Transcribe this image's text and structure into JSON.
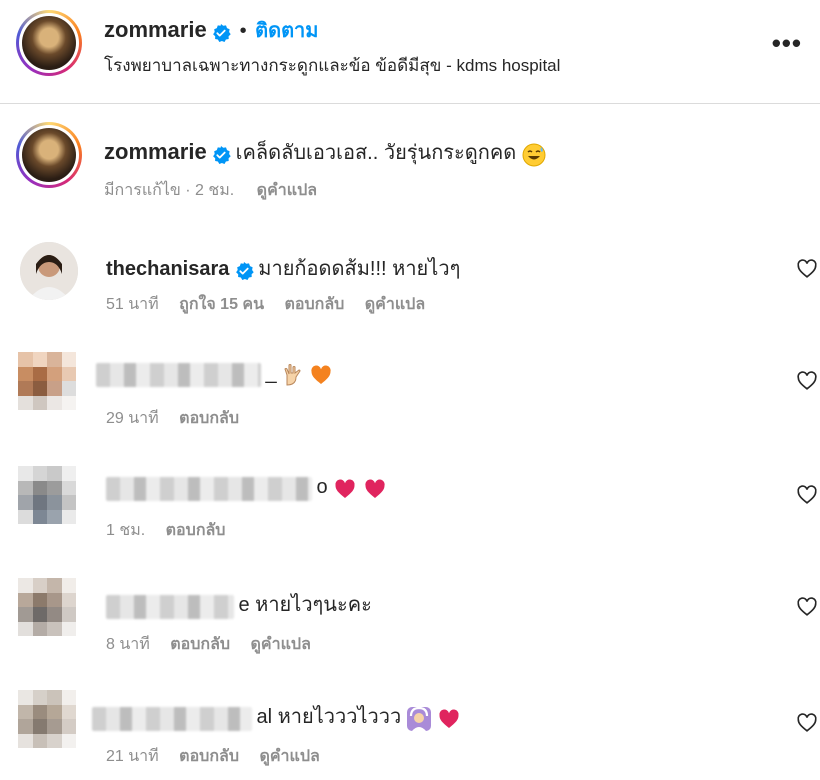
{
  "header": {
    "username": "zommarie",
    "dot": "•",
    "follow_label": "ติดตาม",
    "location": "โรงพยาบาลเฉพาะทางกระดูกและข้อ ข้อดีมีสุข - kdms hospital",
    "more_label": "•••"
  },
  "caption": {
    "username": "zommarie",
    "text": "เคล็ดลับเอวเอส.. วัยรุ่นกระดูกคด",
    "meta": "มีการแก้ไข · 2 ชม.",
    "translate": "ดูคำแปล"
  },
  "comments": [
    {
      "username": "thechanisara",
      "text": "มายก้อดดส้ม!!! หายไวๆ",
      "time": "51 นาที",
      "likes": "ถูกใจ 15 คน",
      "reply": "ตอบกลับ",
      "translate": "ดูคำแปล"
    },
    {
      "text_suffix": "_",
      "time": "29 นาที",
      "reply": "ตอบกลับ"
    },
    {
      "text_suffix": "o",
      "time": "1 ชม.",
      "reply": "ตอบกลับ"
    },
    {
      "text": "e หายไวๆนะคะ",
      "time": "8 นาที",
      "reply": "ตอบกลับ",
      "translate": "ดูคำแปล"
    },
    {
      "text": "al หายไวววไววว",
      "time": "21 นาที",
      "reply": "ตอบกลับ",
      "translate": "ดูคำแปล"
    }
  ],
  "colors": {
    "accent": "#0095f6",
    "secondary_text": "#8e8e8e",
    "heart_red": "#e0245e"
  }
}
